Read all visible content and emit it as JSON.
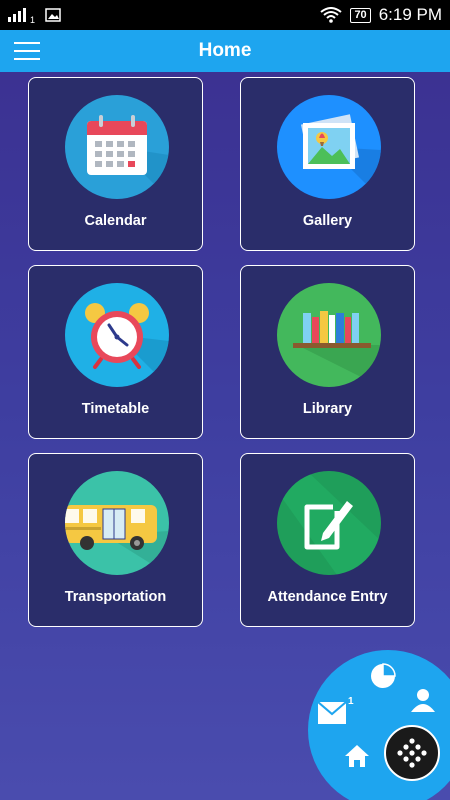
{
  "status_bar": {
    "sim_slot": "1",
    "battery": "70",
    "time": "6:19 PM"
  },
  "app_bar": {
    "title": "Home"
  },
  "tiles": [
    {
      "label": "Calendar",
      "icon": "calendar-icon",
      "color": "#1ea5ef"
    },
    {
      "label": "Gallery",
      "icon": "gallery-icon",
      "color": "#1e90ff"
    },
    {
      "label": "Timetable",
      "icon": "alarm-clock-icon",
      "color": "#1fb0e6"
    },
    {
      "label": "Library",
      "icon": "bookshelf-icon",
      "color": "#43b85c"
    },
    {
      "label": "Transportation",
      "icon": "school-bus-icon",
      "color": "#3bc2a8"
    },
    {
      "label": "Attendance Entry",
      "icon": "edit-icon",
      "color": "#1f9e5a"
    }
  ],
  "fab_menu": {
    "mail_badge": "1",
    "items": [
      "pie-chart-icon",
      "user-icon",
      "mail-icon",
      "home-icon",
      "grid-dots-icon"
    ]
  },
  "colors": {
    "app_bar": "#1ea5ef",
    "tile_bg": "#2a2d6a",
    "page_bg": "#3e3ea0"
  }
}
